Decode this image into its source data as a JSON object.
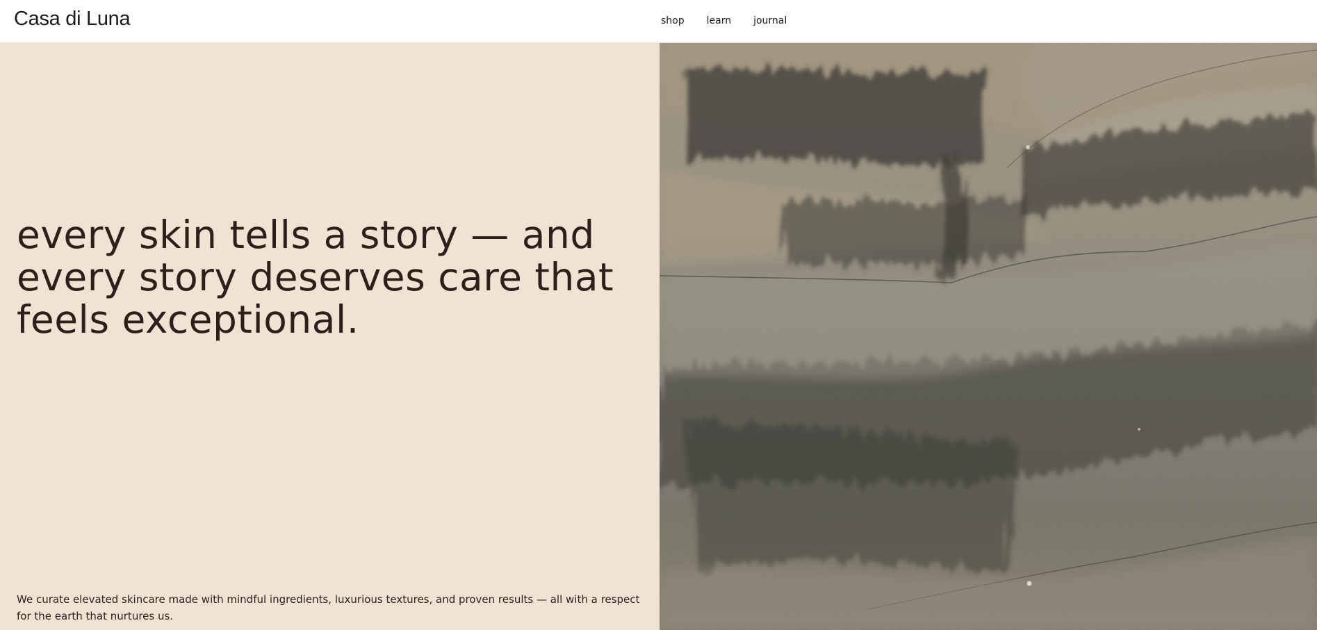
{
  "header": {
    "brand": "Casa di Luna",
    "nav": [
      {
        "label": "shop"
      },
      {
        "label": "learn"
      },
      {
        "label": "journal"
      }
    ]
  },
  "hero": {
    "headline": "every skin tells a story — and every story deserves care that feels exceptional.",
    "intro": "We curate elevated skincare made with mindful ingredients, luxurious textures, and proven results — all with a respect for the earth that nurtures us."
  },
  "colors": {
    "panel_background": "#f1e3d3",
    "headline_text": "#2e1f1d",
    "body_text": "#2a2220"
  }
}
